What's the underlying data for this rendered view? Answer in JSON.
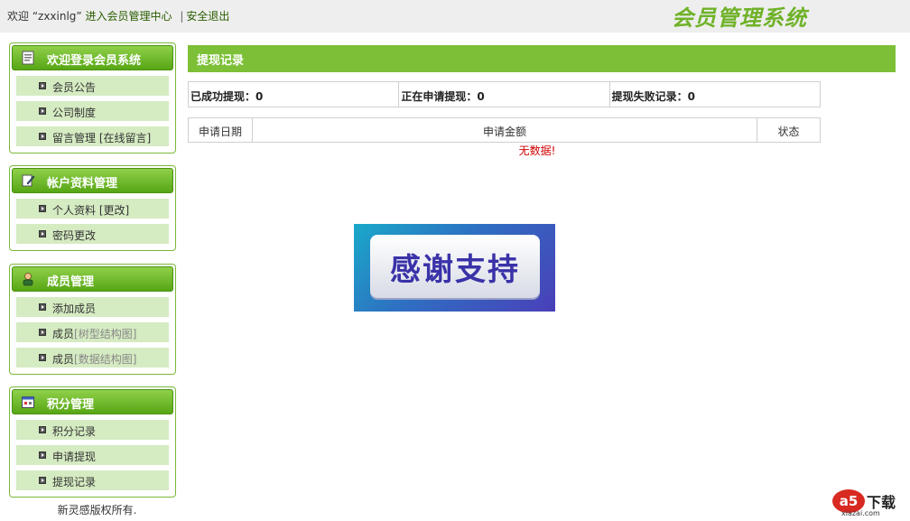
{
  "header": {
    "welcome_prefix": "欢迎 “zxxinlg”",
    "member_center_link": "进入会员管理中心",
    "separator": "|",
    "logout_link": "安全退出",
    "brand": "会员管理系统"
  },
  "sidebar": {
    "panels": [
      {
        "title": "欢迎登录会员系统",
        "icon": "document-icon",
        "items": [
          {
            "label": "会员公告"
          },
          {
            "label": "公司制度"
          },
          {
            "label": "留言管理 [在线留言]"
          }
        ]
      },
      {
        "title": "帐户资料管理",
        "icon": "edit-icon",
        "items": [
          {
            "label": "个人资料 [更改]"
          },
          {
            "label": "密码更改"
          }
        ]
      },
      {
        "title": "成员管理",
        "icon": "user-icon",
        "items": [
          {
            "label": "添加成员"
          },
          {
            "label": "成员",
            "extra": "[树型结构图]"
          },
          {
            "label": "成员",
            "extra": "[数据结构图]"
          }
        ]
      },
      {
        "title": "积分管理",
        "icon": "calendar-icon",
        "items": [
          {
            "label": "积分记录"
          },
          {
            "label": "申请提现"
          },
          {
            "label": "提现记录"
          }
        ]
      }
    ],
    "copyright": "新灵感版权所有."
  },
  "main": {
    "title": "提现记录",
    "stats": {
      "success": "已成功提现：0",
      "pending": "正在申请提现：0",
      "failed": "提现失败记录：0"
    },
    "table": {
      "columns": [
        "申请日期",
        "申请金额",
        "状态"
      ],
      "empty_message": "无数据!"
    },
    "banner_text": "感谢支持"
  },
  "watermark": {
    "badge": "a5",
    "text": "下载",
    "site": "xiazai.com"
  },
  "colors": {
    "accent_green": "#7dc038",
    "panel_border": "#7ab83a",
    "menu_item_bg": "#d5ebc2",
    "brand_green": "#6fb228",
    "empty_text": "#d00000"
  }
}
